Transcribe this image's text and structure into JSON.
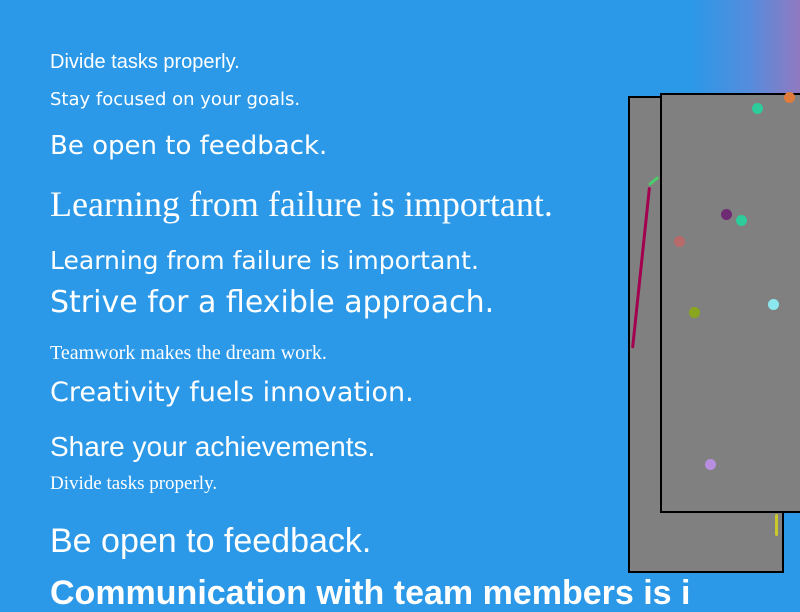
{
  "lines": [
    "Divide tasks properly.",
    "Stay focused on your goals.",
    "Be open to feedback.",
    "Learning from failure is important.",
    "Learning from failure is important.",
    "Strive for a flexible approach.",
    "Teamwork makes the dream work.",
    "Creativity fuels innovation.",
    "Share your achievements.",
    "Divide tasks properly.",
    "Be open to feedback.",
    "Communication with team members is i"
  ],
  "colors": {
    "background": "#2b98e8",
    "panel": "#808080",
    "panel_border": "#000000",
    "text": "#ffffff"
  },
  "canvas_marks": {
    "dot_colors": [
      "#2ecc9a",
      "#e07b3c",
      "#6e2a72",
      "#2ecc9a",
      "#b86a6a",
      "#8cc9e8",
      "#8aa51e",
      "#b88fe0"
    ],
    "stroke_colors": [
      "#a3004f",
      "#4ccf6a",
      "#c9c92a"
    ]
  }
}
